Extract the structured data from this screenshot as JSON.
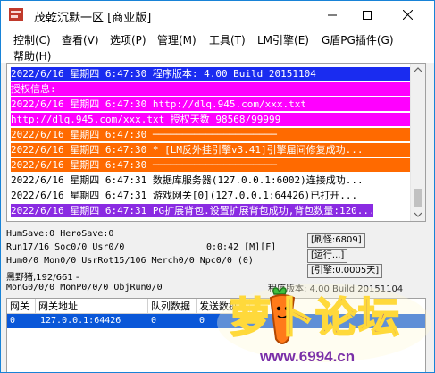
{
  "window": {
    "title": "茂乾沉默一区 [商业版]",
    "icon": "app-red-icon",
    "controls": [
      "minimize-icon",
      "maximize-icon",
      "close-icon"
    ]
  },
  "menu": {
    "items": [
      "控制(C)",
      "查看(V)",
      "选项(P)",
      "管理(M)",
      "工具(T)",
      "LM引擎(E)",
      "G盾PG插件(G)",
      "帮助(H)"
    ]
  },
  "log": {
    "lines": [
      {
        "text": "2022/6/16 星期四 6:47:30 程序版本: 4.00 Build 20151104",
        "bg": "#1a2cf0",
        "fg": "#ffffff"
      },
      {
        "text": "授权信息:",
        "bg": "#ff00ff",
        "fg": "#ffffff"
      },
      {
        "text": "2022/6/16 星期四 6:47:30 http://dlq.945.com/xxx.txt",
        "bg": "#ff00ff",
        "fg": "#ffffff"
      },
      {
        "text": "http://dlq.945.com/xxx.txt 授权天数 98568/99999",
        "bg": "#ff00ff",
        "fg": "#ffffff"
      },
      {
        "text": "2022/6/16 星期四 6:47:30 ─────────────────────",
        "bg": "#ff6a00",
        "fg": "#ffffff"
      },
      {
        "text": "2022/6/16 星期四 6:47:30 * [LM反外挂引擎v3.41]引擎届间修复成功...",
        "bg": "#ff6a00",
        "fg": "#ffffff"
      },
      {
        "text": "2022/6/16 星期四 6:47:30 ─────────────────────",
        "bg": "#ff6a00",
        "fg": "#ffffff"
      },
      {
        "text": "2022/6/16 星期四 6:47:31 数据库服务器(127.0.0.1:6002)连接成功...",
        "bg": "#ffffff",
        "fg": "#000000"
      },
      {
        "text": "2022/6/16 星期四 6:47:31 游戏网关[0](127.0.0.1:64426)已打开...",
        "bg": "#ffffff",
        "fg": "#000000"
      },
      {
        "text": "2022/6/16 星期四 6:47:31 PG扩展背包.设置扩展背包成功,背包数量:120...",
        "bg": "#8a2be2",
        "fg": "#ffffff"
      }
    ]
  },
  "status": {
    "hum_save": "HumSave:0 HeroSave:0",
    "run": "Run17/16 Soc0/0 Usr0/0",
    "time": "0:0:42 [M][F]",
    "hum": "Hum0/0 Mon0/0 UsrRot15/106 Merch0/0 Npc0/0 (0)",
    "black_wild": "黑野猪,192/661 -",
    "mon": "MonG0/0/0 MonP0/0/0 ObjRun0/0",
    "refresh_monster": "[刷怪:6809]",
    "running": "[运行...]",
    "engine": "[引擎:0.0005天]",
    "version": "程序版本: 4.00 Build 20151104"
  },
  "table": {
    "headers": [
      "网关",
      "网关地址",
      "队列数据",
      "发送数据"
    ],
    "rows": [
      [
        "0",
        "127.0.0.1:64426",
        "0",
        "0"
      ]
    ]
  },
  "watermark": {
    "brand": "萝卜论坛",
    "url": "www.6994.cn"
  }
}
